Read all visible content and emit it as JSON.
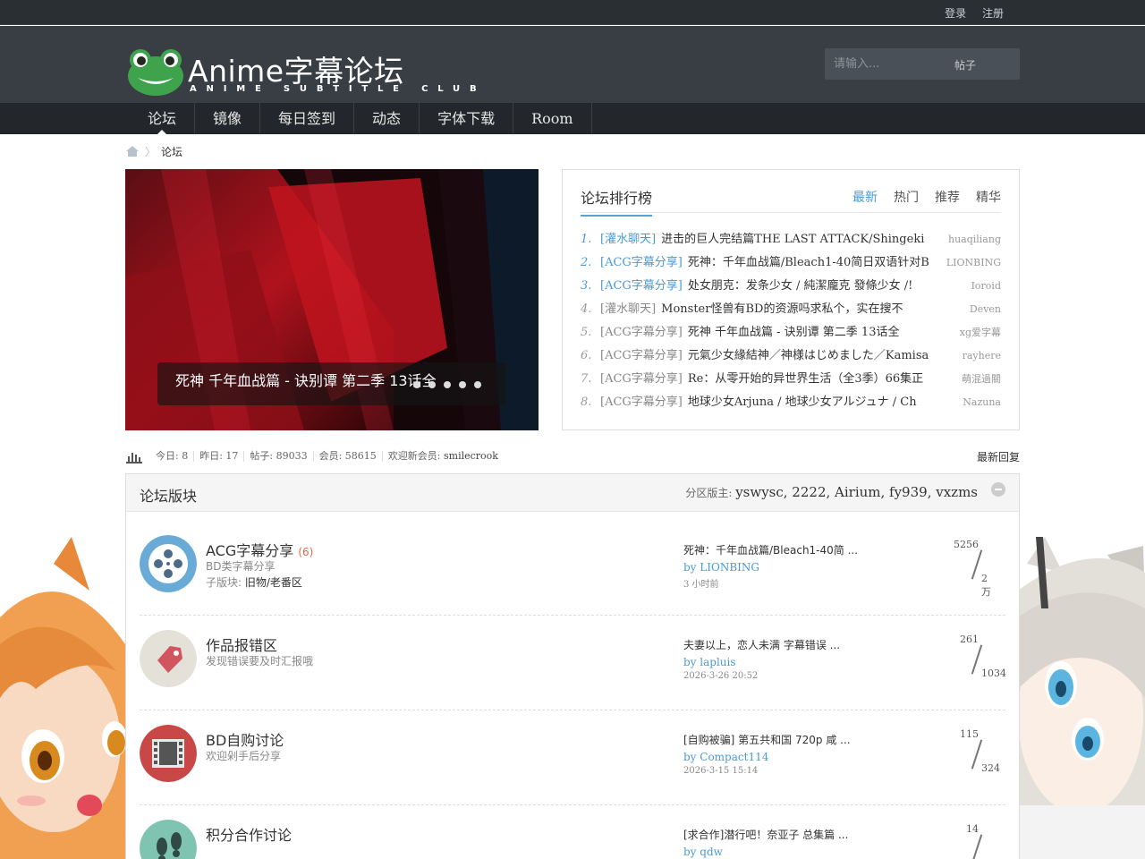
{
  "topbar": {
    "login": "登录",
    "register": "注册"
  },
  "logo": {
    "title": "Anime字幕论坛",
    "subtitle": "ANIME SUBTITLE CLUB"
  },
  "search": {
    "placeholder": "请输入...",
    "type": "帖子"
  },
  "nav": [
    {
      "label": "论坛",
      "active": true
    },
    {
      "label": "镜像"
    },
    {
      "label": "每日签到"
    },
    {
      "label": "动态"
    },
    {
      "label": "字体下载"
    },
    {
      "label": "Room"
    }
  ],
  "breadcrumb": {
    "current": "论坛"
  },
  "slider": {
    "caption": "死神 千年血战篇 - 诀别谭 第二季 13话全"
  },
  "ranking": {
    "title": "论坛排行榜",
    "tabs": [
      "最新",
      "热门",
      "推荐",
      "精华"
    ],
    "items": [
      {
        "n": "1.",
        "cat": "[灌水聊天]",
        "title": "进击的巨人完结篇THE LAST ATTACK/Shingeki",
        "user": "huaqiliang"
      },
      {
        "n": "2.",
        "cat": "[ACG字幕分享]",
        "title": "死神：千年血战篇/Bleach1-40简日双语针对B",
        "user": "LIONBING"
      },
      {
        "n": "3.",
        "cat": "[ACG字幕分享]",
        "title": "处女朋克：发条少女 / 純潔龐克 發條少女 /!",
        "user": "Ioroid"
      },
      {
        "n": "4.",
        "cat": "[灌水聊天]",
        "title": "Monster怪兽有BD的资源吗求私个，实在搜不",
        "user": "Deven"
      },
      {
        "n": "5.",
        "cat": "[ACG字幕分享]",
        "title": "死神 千年血战篇 - 诀别谭 第二季 13话全",
        "user": "xg爱字幕"
      },
      {
        "n": "6.",
        "cat": "[ACG字幕分享]",
        "title": "元氣少女緣結神／神様はじめました／Kamisa",
        "user": "rayhere"
      },
      {
        "n": "7.",
        "cat": "[ACG字幕分享]",
        "title": "Re：从零开始的异世界生活（全3季）66集正",
        "user": "萌混過關"
      },
      {
        "n": "8.",
        "cat": "[ACG字幕分享]",
        "title": "地球少女Arjuna / 地球少女アルジュナ / Ch",
        "user": "Nazuna"
      }
    ]
  },
  "stats": {
    "today": "今日: 8",
    "yesterday": "昨日: 17",
    "posts": "帖子: 89033",
    "members": "会员: 58615",
    "welcome_label": "欢迎新会员: ",
    "welcome_user": "smilecrook",
    "latest_reply": "最新回复"
  },
  "board": {
    "title": "论坛版块",
    "mods_label": "分区版主: ",
    "mods": "yswysc, 2222, Airium, fy939, vxzms",
    "forums": [
      {
        "name": "ACG字幕分享",
        "count": "(6)",
        "desc": "BD类字幕分享",
        "sub_label": "子版块: ",
        "sub": "旧物/老番区",
        "last_title": "死神：千年血战篇/Bleach1-40简 ...",
        "last_by": "by  LIONBING",
        "last_time": "3 小时前",
        "threads": "5256",
        "posts": "2万"
      },
      {
        "name": "作品报错区",
        "desc": "发现错误要及时汇报哦",
        "last_title": "夫妻以上，恋人未满 字幕错误 ...",
        "last_by": "by  lapluis",
        "last_time": "2026-3-26 20:52",
        "threads": "261",
        "posts": "1034"
      },
      {
        "name": "BD自购讨论",
        "desc": "欢迎剁手后分享",
        "last_title": "[自购被骗] 第五共和国 720p 咸 ...",
        "last_by": "by  Compact114",
        "last_time": "2026-3-15 15:14",
        "threads": "115",
        "posts": "324"
      },
      {
        "name": "积分合作讨论",
        "desc": "",
        "last_title": "[求合作]潜行吧！奈亚子 总集篇 ...",
        "last_by": "by  qdw",
        "last_time": "",
        "threads": "14",
        "posts": ""
      }
    ]
  }
}
